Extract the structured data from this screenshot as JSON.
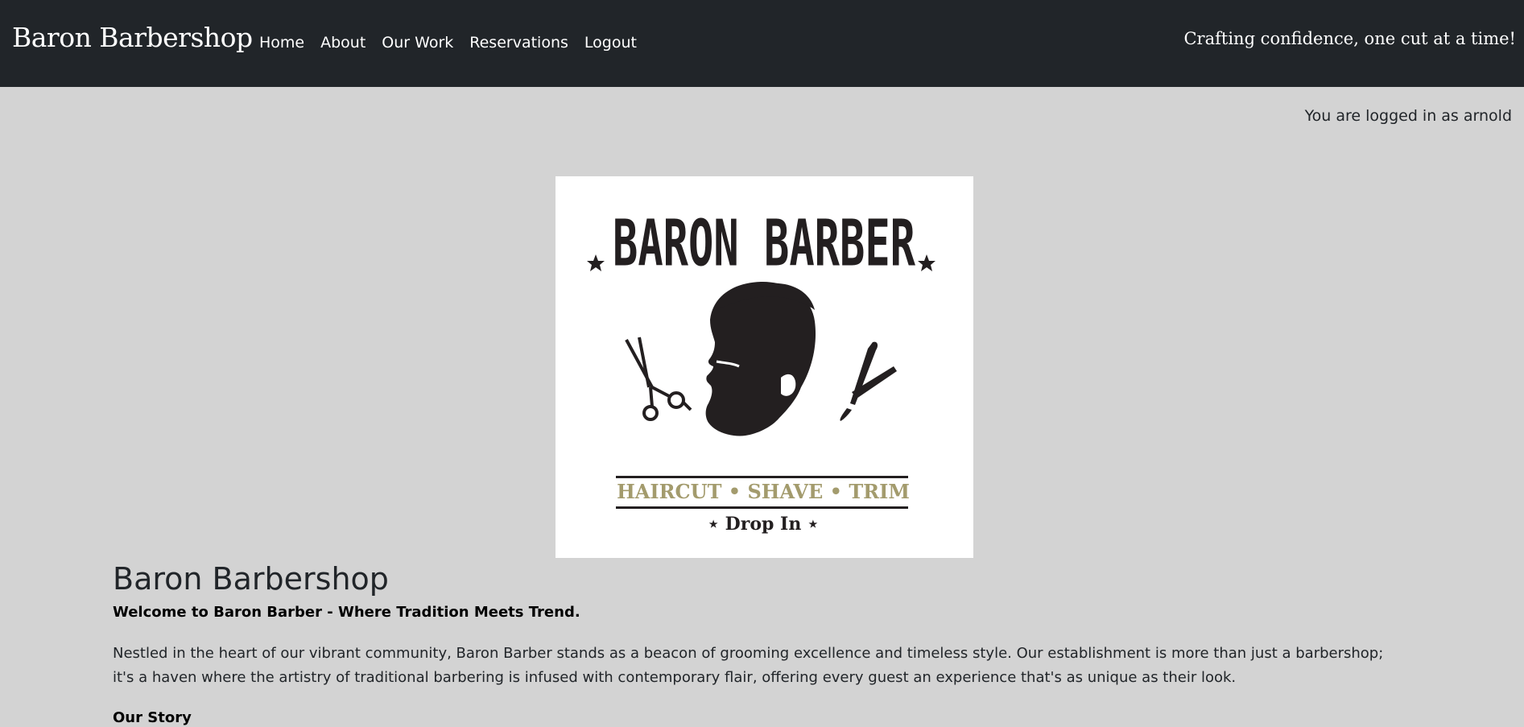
{
  "navbar": {
    "brand": "Baron Barbershop",
    "links": [
      "Home",
      "About",
      "Our Work",
      "Reservations",
      "Logout"
    ],
    "tagline": "Crafting confidence, one cut at a time!"
  },
  "status": {
    "logged_in_text": "You are logged in as arnold"
  },
  "logo": {
    "title": "BARON BARBER",
    "services": "HAIRCUT • SHAVE • TRIM",
    "drop_in": "⋆ Drop In ⋆",
    "accent_color": "#a39b6d"
  },
  "main": {
    "title": "Baron Barbershop",
    "welcome": "Welcome to Baron Barber - Where Tradition Meets Trend.",
    "intro": "Nestled in the heart of our vibrant community, Baron Barber stands as a beacon of grooming excellence and timeless style. Our establishment is more than just a barbershop; it's a haven where the artistry of traditional barbering is infused with contemporary flair, offering every guest an experience that's as unique as their look.",
    "story_heading": "Our Story"
  }
}
